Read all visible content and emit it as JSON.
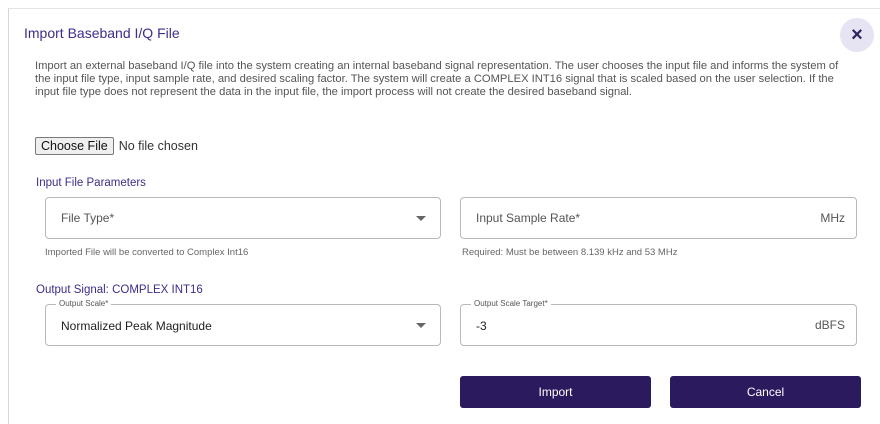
{
  "dialog": {
    "title": "Import Baseband I/Q File",
    "close_icon": "×",
    "description": "Import an external baseband I/Q file into the system creating an internal baseband signal representation. The user chooses the input file and informs the system of the input file type, input sample rate, and desired scaling factor. The system will create a COMPLEX INT16 signal that is scaled based on the user selection. If the input file type does not represent the data in the input file, the import process will not create the desired baseband signal."
  },
  "file_input": {
    "button_label": "Choose File",
    "status": "No file chosen"
  },
  "input_params": {
    "section_label": "Input File Parameters",
    "file_type": {
      "placeholder": "File Type*",
      "helper": "Imported File will be converted to Complex Int16"
    },
    "sample_rate": {
      "placeholder": "Input Sample Rate*",
      "unit": "MHz",
      "helper": "Required: Must be between 8.139 kHz and 53 MHz"
    }
  },
  "output_signal": {
    "section_label": "Output Signal: COMPLEX INT16",
    "scale": {
      "label": "Output Scale*",
      "value": "Normalized Peak Magnitude"
    },
    "scale_target": {
      "label": "Output Scale Target*",
      "value": "-3",
      "unit": "dBFS"
    }
  },
  "actions": {
    "import_label": "Import",
    "cancel_label": "Cancel"
  },
  "colors": {
    "accent": "#3b2f8a",
    "button_bg": "#2c1a5e",
    "close_bg": "#e6e3f3"
  }
}
